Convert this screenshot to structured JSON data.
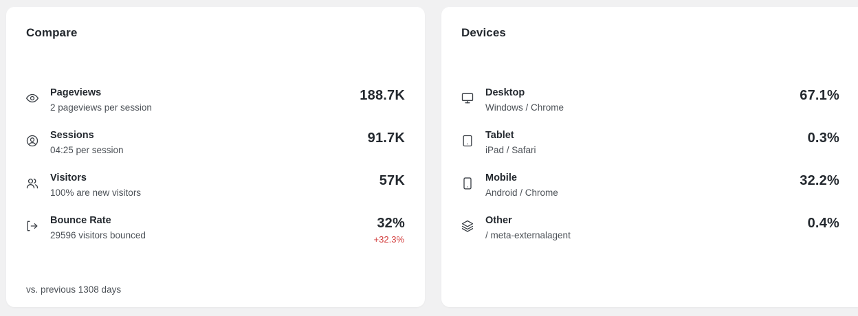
{
  "compare": {
    "title": "Compare",
    "rows": [
      {
        "title": "Pageviews",
        "subtitle": "2 pageviews per session",
        "value": "188.7K",
        "icon": "eye-icon"
      },
      {
        "title": "Sessions",
        "subtitle": "04:25 per session",
        "value": "91.7K",
        "icon": "user-circle-icon"
      },
      {
        "title": "Visitors",
        "subtitle": "100% are new visitors",
        "value": "57K",
        "icon": "users-icon"
      },
      {
        "title": "Bounce Rate",
        "subtitle": "29596 visitors bounced",
        "value": "32%",
        "change": "+32.3%",
        "icon": "exit-icon"
      }
    ],
    "footer": "vs. previous 1308 days"
  },
  "devices": {
    "title": "Devices",
    "rows": [
      {
        "title": "Desktop",
        "subtitle": "Windows / Chrome",
        "value": "67.1%",
        "icon": "desktop-icon"
      },
      {
        "title": "Tablet",
        "subtitle": "iPad / Safari",
        "value": "0.3%",
        "icon": "tablet-icon"
      },
      {
        "title": "Mobile",
        "subtitle": "Android / Chrome",
        "value": "32.2%",
        "icon": "mobile-icon"
      },
      {
        "title": "Other",
        "subtitle": "/ meta-externalagent",
        "value": "0.4%",
        "icon": "layers-icon"
      }
    ]
  },
  "colors": {
    "negative_change": "#d23b3b",
    "background": "#f1f1f2",
    "card": "#ffffff"
  }
}
